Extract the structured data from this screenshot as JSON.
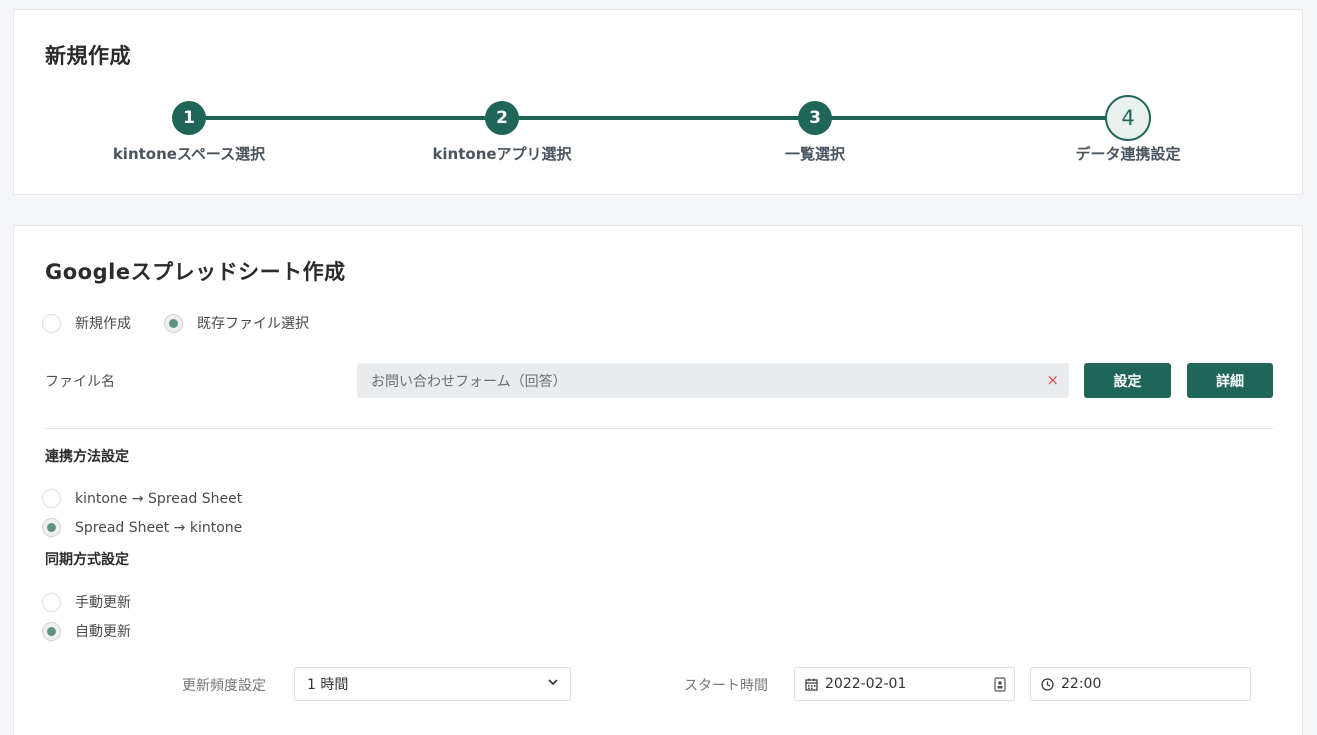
{
  "header": {
    "title": "新規作成",
    "steps": [
      {
        "number": "1",
        "label": "kintoneスペース選択"
      },
      {
        "number": "2",
        "label": "kintoneアプリ選択"
      },
      {
        "number": "3",
        "label": "一覧選択"
      },
      {
        "number": "4",
        "label": "データ連携設定"
      }
    ],
    "current_step": 4
  },
  "sheet": {
    "title": "Googleスプレッドシート作成",
    "mode_options": [
      {
        "label": "新規作成",
        "checked": false
      },
      {
        "label": "既存ファイル選択",
        "checked": true
      }
    ],
    "file_label": "ファイル名",
    "file_value": "お問い合わせフォーム（回答）",
    "clear_symbol": "×",
    "set_button": "設定",
    "detail_button": "詳細"
  },
  "link_method": {
    "label": "連携方法設定",
    "options": [
      {
        "label": "kintone → Spread Sheet",
        "checked": false
      },
      {
        "label": "Spread Sheet → kintone",
        "checked": true
      }
    ]
  },
  "sync_method": {
    "label": "同期方式設定",
    "options": [
      {
        "label": "手動更新",
        "checked": false
      },
      {
        "label": "自動更新",
        "checked": true
      }
    ]
  },
  "schedule": {
    "frequency_label": "更新頻度設定",
    "frequency_value": "1 時間",
    "start_label": "スタート時間",
    "start_date": "2022-02-01",
    "start_time": "22:00"
  },
  "colors": {
    "accent": "#1f6659",
    "radio_checked": "#5e9286",
    "clear": "#e04a4a"
  }
}
